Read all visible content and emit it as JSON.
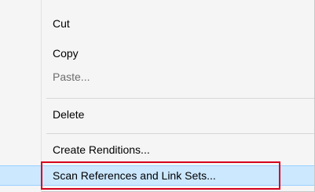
{
  "context_menu": {
    "items": [
      {
        "label": "Cut",
        "enabled": true
      },
      {
        "label": "Copy",
        "enabled": true
      },
      {
        "label": "Paste...",
        "enabled": false
      },
      {
        "label": "Delete",
        "enabled": true
      },
      {
        "label": "Create Renditions...",
        "enabled": true
      },
      {
        "label": "Scan References and Link Sets...",
        "enabled": true,
        "highlighted": true
      }
    ]
  },
  "colors": {
    "menu_background": "#f5f5f5",
    "highlight_background": "#cce8ff",
    "highlight_border": "#99d1ff",
    "callout_border": "#d6001c",
    "disabled_text": "#6d6d6d"
  }
}
